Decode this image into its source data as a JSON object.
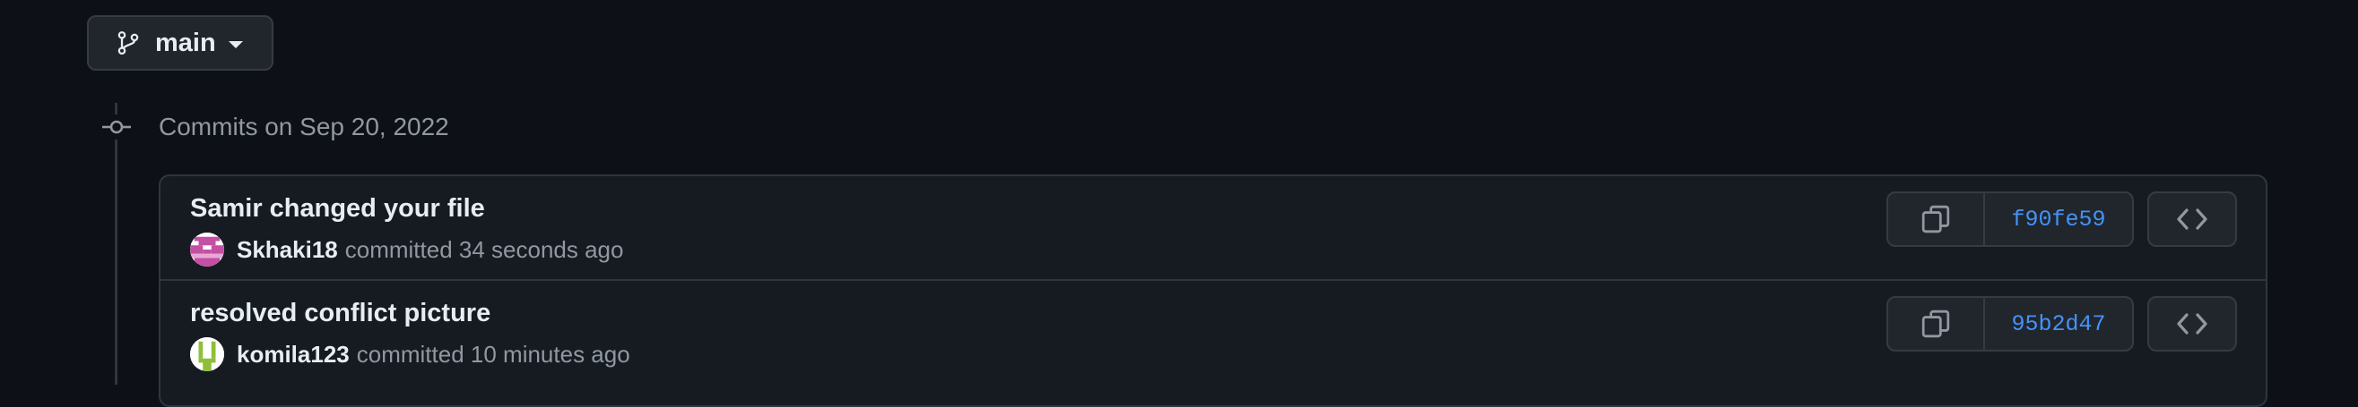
{
  "branch": {
    "label": "main",
    "icon": "git-branch-icon"
  },
  "timeline": {
    "date_heading": "Commits on Sep 20, 2022",
    "icon": "git-commit-icon"
  },
  "commits": [
    {
      "title": "Samir changed your file",
      "author": "Skhaki18",
      "committed_text": "committed 34 seconds ago",
      "sha": "f90fe59",
      "avatar_colors": [
        "#c44fa3",
        "#ffffff"
      ]
    },
    {
      "title": "resolved conflict picture",
      "author": "komila123",
      "committed_text": "committed 10 minutes ago",
      "sha": "95b2d47",
      "avatar_colors": [
        "#8fbf3a",
        "#ffffff"
      ]
    }
  ],
  "icons": {
    "copy": "copy-icon",
    "browse": "code-icon"
  },
  "colors": {
    "background": "#0d1117",
    "box_background": "#161b22",
    "border": "#30363d",
    "button_background": "#21262d",
    "link_blue": "#4493f8",
    "muted_text": "#9198a1",
    "primary_text": "#e6edf3"
  }
}
